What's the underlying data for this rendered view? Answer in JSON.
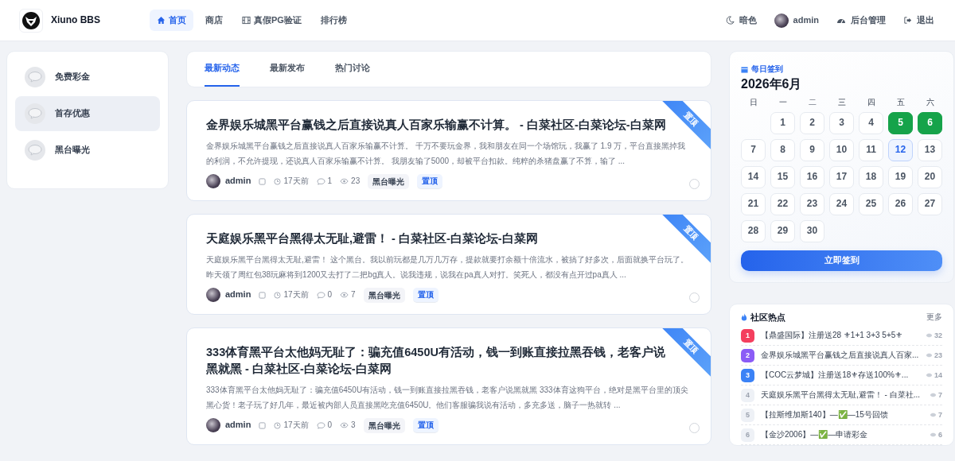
{
  "header": {
    "brand": "Xiuno BBS",
    "nav": [
      {
        "label": "首页",
        "selected": true,
        "kind": "home"
      },
      {
        "label": "商店",
        "selected": false,
        "kind": "plain"
      },
      {
        "label": "真假PG验证",
        "selected": false,
        "kind": "film"
      },
      {
        "label": "排行榜",
        "selected": false,
        "kind": "plain"
      }
    ],
    "actions": [
      {
        "kind": "theme",
        "label": "暗色"
      },
      {
        "kind": "user",
        "label": "admin"
      },
      {
        "kind": "admin",
        "label": "后台管理"
      },
      {
        "kind": "logout",
        "label": "退出"
      }
    ]
  },
  "sidebar": {
    "items": [
      {
        "label": "免费彩金",
        "selected": false
      },
      {
        "label": "首存优惠",
        "selected": true
      },
      {
        "label": "黑台曝光",
        "selected": false
      }
    ]
  },
  "tabs": [
    {
      "label": "最新动态",
      "selected": true
    },
    {
      "label": "最新发布",
      "selected": false
    },
    {
      "label": "热门讨论",
      "selected": false
    }
  ],
  "posts": [
    {
      "title": "金界娱乐城黑平台赢钱之后直接说真人百家乐输赢不计算。 - 白菜社区-白菜论坛-白菜网",
      "excerpt": "金界娱乐城黑平台赢钱之后直接说真人百家乐输赢不计算。 千万不要玩金界，我和朋友在同一个场馆玩，我赢了 1.9 万，平台直接黑掉我的利润，不允许提现，还说真人百家乐输赢不计算。 我朋友输了5000，却被平台扣款。纯粹的杀猪盘赢了不算，输了 ...",
      "ribbon": "置顶",
      "author": "admin",
      "time": "17天前",
      "comments": "1",
      "views": "23",
      "tags": [
        {
          "label": "黑台曝光",
          "kind": "forum"
        },
        {
          "label": "置顶",
          "kind": "top"
        }
      ],
      "selected": false
    },
    {
      "title": "天庭娱乐黑平台黑得太无耻,避雷！ - 白菜社区-白菜论坛-白菜网",
      "excerpt": "天庭娱乐黑平台黑得太无耻,避雷！ 这个黑台。我以前玩都是几万几万存，提款就要打余额十倍流水，被搞了好多次，后面就换平台玩了。昨天领了周红包38玩麻将到1200又去打了二把bg真人。说我违规，说我在pa真人对打。笑死人，都没有点开过pa真人 ...",
      "ribbon": "置顶",
      "author": "admin",
      "time": "17天前",
      "comments": "0",
      "views": "7",
      "tags": [
        {
          "label": "黑台曝光",
          "kind": "forum"
        },
        {
          "label": "置顶",
          "kind": "top"
        }
      ],
      "selected": false
    },
    {
      "title": "333体育黑平台太他妈无耻了：骗充值6450U有活动，钱一到账直接拉黑吞钱，老客户说黑就黑 - 白菜社区-白菜论坛-白菜网",
      "excerpt": "333体育黑平台太他妈无耻了：骗充值6450U有活动，钱一到账直接拉黑吞钱，老客户说黑就黑 333体育这狗平台，绝对是黑平台里的顶尖黑心货！老子玩了好几年，最近被内部人员直接黑吃充值6450U。他们客服骗我说有活动，多充多送，脑子一热就转 ...",
      "ribbon": "置顶",
      "author": "admin",
      "time": "17天前",
      "comments": "0",
      "views": "3",
      "tags": [
        {
          "label": "黑台曝光",
          "kind": "forum"
        },
        {
          "label": "置顶",
          "kind": "top"
        }
      ],
      "selected": false
    }
  ],
  "checkin": {
    "label": "每日签到",
    "month": "2026年6月",
    "weekdays": [
      "日",
      "一",
      "二",
      "三",
      "四",
      "五",
      "六"
    ],
    "days": [
      {
        "kind": "blank"
      },
      {
        "kind": "day",
        "label": "1",
        "signed": false,
        "today": false
      },
      {
        "kind": "day",
        "label": "2",
        "signed": false,
        "today": false
      },
      {
        "kind": "day",
        "label": "3",
        "signed": false,
        "today": false
      },
      {
        "kind": "day",
        "label": "4",
        "signed": false,
        "today": false
      },
      {
        "kind": "day",
        "label": "5",
        "signed": true,
        "today": false
      },
      {
        "kind": "day",
        "label": "6",
        "signed": true,
        "today": false
      },
      {
        "kind": "day",
        "label": "7",
        "signed": false,
        "today": false
      },
      {
        "kind": "day",
        "label": "8",
        "signed": false,
        "today": false
      },
      {
        "kind": "day",
        "label": "9",
        "signed": false,
        "today": false
      },
      {
        "kind": "day",
        "label": "10",
        "signed": false,
        "today": false
      },
      {
        "kind": "day",
        "label": "11",
        "signed": false,
        "today": false
      },
      {
        "kind": "day",
        "label": "12",
        "signed": false,
        "today": true
      },
      {
        "kind": "day",
        "label": "13",
        "signed": false,
        "today": false
      },
      {
        "kind": "day",
        "label": "14",
        "signed": false,
        "today": false
      },
      {
        "kind": "day",
        "label": "15",
        "signed": false,
        "today": false
      },
      {
        "kind": "day",
        "label": "16",
        "signed": false,
        "today": false
      },
      {
        "kind": "day",
        "label": "17",
        "signed": false,
        "today": false
      },
      {
        "kind": "day",
        "label": "18",
        "signed": false,
        "today": false
      },
      {
        "kind": "day",
        "label": "19",
        "signed": false,
        "today": false
      },
      {
        "kind": "day",
        "label": "20",
        "signed": false,
        "today": false
      },
      {
        "kind": "day",
        "label": "21",
        "signed": false,
        "today": false
      },
      {
        "kind": "day",
        "label": "22",
        "signed": false,
        "today": false
      },
      {
        "kind": "day",
        "label": "23",
        "signed": false,
        "today": false
      },
      {
        "kind": "day",
        "label": "24",
        "signed": false,
        "today": false
      },
      {
        "kind": "day",
        "label": "25",
        "signed": false,
        "today": false
      },
      {
        "kind": "day",
        "label": "26",
        "signed": false,
        "today": false
      },
      {
        "kind": "day",
        "label": "27",
        "signed": false,
        "today": false
      },
      {
        "kind": "day",
        "label": "28",
        "signed": false,
        "today": false
      },
      {
        "kind": "day",
        "label": "29",
        "signed": false,
        "today": false
      },
      {
        "kind": "day",
        "label": "30",
        "signed": false,
        "today": false
      }
    ],
    "button": "立即签到"
  },
  "hot": {
    "title": "社区热点",
    "more": "更多",
    "items": [
      {
        "rank": "1",
        "color": "#f43f5e",
        "title": "【鼎盛国际】注册送28 ⚜1+1 3+3 5+5⚜",
        "views": "32"
      },
      {
        "rank": "2",
        "color": "#8b5cf6",
        "title": "金界娱乐城黑平台赢钱之后直接说真人百家...",
        "views": "23"
      },
      {
        "rank": "3",
        "color": "#3b82f6",
        "title": "【COC云梦城】注册送18⚜存送100%⚜...",
        "views": "14"
      },
      {
        "rank": "4",
        "color": "#eef1f6",
        "title": "天庭娱乐黑平台黑得太无耻,避雷！ - 白菜社...",
        "views": "7"
      },
      {
        "rank": "5",
        "color": "#eef1f6",
        "title": "【拉斯维加斯140】—✅—15号回馈",
        "views": "7"
      },
      {
        "rank": "6",
        "color": "#eef1f6",
        "title": "【金沙2006】—✅—申请彩金",
        "views": "6"
      }
    ]
  }
}
